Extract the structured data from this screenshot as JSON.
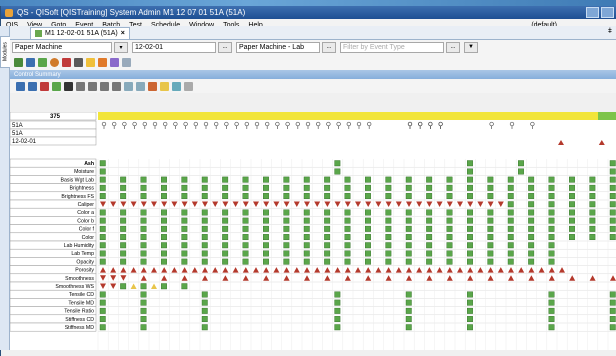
{
  "window": {
    "title": "QS - QISoft [QISTraining]  System Admin  M1  12 07 01  51A (51A)"
  },
  "menu": {
    "items": [
      "QIS",
      "View",
      "Goto",
      "Event",
      "Batch",
      "Test",
      "Schedule",
      "Window",
      "Tools",
      "Help"
    ],
    "default_label": "(default)"
  },
  "side_tab": {
    "label": "Modules"
  },
  "doc_tab": {
    "label": "M1 12-02-01 51A (51A)",
    "close": "×",
    "pin": "ǂ"
  },
  "filters": {
    "machine": "Paper Machine",
    "date": "12-02-01",
    "lab": "Paper Machine - Lab",
    "event_placeholder": "Filter by Event Type",
    "ellipsis": "..."
  },
  "summary": {
    "title": "Control Summary"
  },
  "grid": {
    "header_rows": [
      "375",
      "51A",
      "51A",
      "12-02-01"
    ],
    "tests": [
      "Ash",
      "Moisture",
      "Basis Wgt Lab",
      "Brightness",
      "Brightness FS",
      "Caliper",
      "Color a",
      "Color b",
      "Color f",
      "Color",
      "Lab Humidity",
      "Lab Temp",
      "Opacity",
      "Porosity",
      "Smoothness",
      "Smoothness WS",
      "Tensile CD",
      "Tensile MD",
      "Tensile Ratio",
      "Stiffness CD",
      "Stiffness MD"
    ]
  },
  "colors": {
    "ok": "#5aa64a",
    "alarm": "#b4392c",
    "warn": "#e8c54a",
    "header_yellow": "#f2e53a",
    "header_green": "#7dc44a"
  }
}
